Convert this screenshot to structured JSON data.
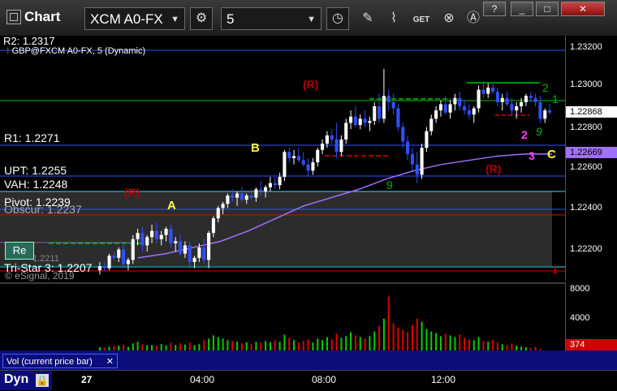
{
  "window": {
    "title": "Chart",
    "help": "?",
    "minimize": "_",
    "maximize": "□",
    "close": "✕"
  },
  "toolbar": {
    "symbol": "XCM A0-FX",
    "interval": "5"
  },
  "chart": {
    "legend": "GBP@FXCM A0-FX, 5 (Dynamic)",
    "copyright": "© eSignal, 2019",
    "r2_partial": "R2: 1.2317",
    "levels": {
      "r1": "R1: 1.2271",
      "upt": "UPT: 1.2255",
      "vah": "VAH: 1.2248",
      "pivot": "Pivot: 1.2239",
      "obscured": "Obscur: 1.2237",
      "tristar": "Tri-Star 3: 1.2207",
      "mini": "1.2211"
    },
    "axis_prices": [
      "1.23200",
      "1.23000",
      "1.22800",
      "1.22600",
      "1.22400",
      "1.22200"
    ],
    "last_price": "1.22868",
    "vwap_price": "1.22669",
    "button_label": "Re",
    "markers": {
      "a": "A",
      "b": "B",
      "c": "C",
      "r_top": "(R)",
      "r_left": "(R)",
      "r_right": "(R)",
      "n9": "9",
      "n2": "2",
      "n3": "3",
      "n1": "1",
      "n9b": "9",
      "n2b": "2",
      "n1b": "1"
    }
  },
  "volume": {
    "label": "Vol (current price bar)",
    "axis_prices": [
      "8000",
      "4000"
    ],
    "current": "374"
  },
  "timeline": {
    "label": "Dyn",
    "ticks": [
      "27",
      "04:00",
      "08:00",
      "12:00"
    ]
  },
  "colors": {
    "green": "#00d000",
    "blue": "#3050ff",
    "red": "#e00000",
    "purple": "#a070ff",
    "yellow": "#ffff40",
    "magenta": "#ff40ff",
    "darkred": "#b00000",
    "lock_orange": "#e08000"
  },
  "chart_data": {
    "type": "candlestick",
    "ohlc": [
      [
        1.2211,
        1.2215,
        1.2209,
        1.2213
      ],
      [
        1.2213,
        1.2215,
        1.2211,
        1.2212
      ],
      [
        1.2212,
        1.2219,
        1.2211,
        1.2218
      ],
      [
        1.2218,
        1.222,
        1.2216,
        1.2217
      ],
      [
        1.2217,
        1.2222,
        1.2215,
        1.2221
      ],
      [
        1.2221,
        1.2223,
        1.2212,
        1.2214
      ],
      [
        1.2214,
        1.2217,
        1.2211,
        1.2216
      ],
      [
        1.2216,
        1.2228,
        1.2214,
        1.2226
      ],
      [
        1.2226,
        1.2231,
        1.2223,
        1.2229
      ],
      [
        1.2229,
        1.2232,
        1.222,
        1.2223
      ],
      [
        1.2223,
        1.2228,
        1.222,
        1.2227
      ],
      [
        1.2227,
        1.2233,
        1.2224,
        1.223
      ],
      [
        1.223,
        1.2234,
        1.2224,
        1.2226
      ],
      [
        1.2226,
        1.223,
        1.2223,
        1.2228
      ],
      [
        1.2228,
        1.2232,
        1.2225,
        1.2231
      ],
      [
        1.2231,
        1.2233,
        1.2222,
        1.2224
      ],
      [
        1.2224,
        1.2227,
        1.222,
        1.2225
      ],
      [
        1.2225,
        1.2228,
        1.2218,
        1.2219
      ],
      [
        1.2219,
        1.2225,
        1.2217,
        1.2223
      ],
      [
        1.2223,
        1.2225,
        1.2212,
        1.2215
      ],
      [
        1.2215,
        1.2218,
        1.2212,
        1.2217
      ],
      [
        1.2217,
        1.2224,
        1.2215,
        1.2222
      ],
      [
        1.2222,
        1.2226,
        1.2214,
        1.2216
      ],
      [
        1.2216,
        1.223,
        1.2212,
        1.2229
      ],
      [
        1.2229,
        1.2237,
        1.2227,
        1.2236
      ],
      [
        1.2236,
        1.2242,
        1.2234,
        1.2241
      ],
      [
        1.2241,
        1.2244,
        1.2238,
        1.2243
      ],
      [
        1.2243,
        1.2248,
        1.2241,
        1.2247
      ],
      [
        1.2247,
        1.225,
        1.2244,
        1.2246
      ],
      [
        1.2246,
        1.2249,
        1.2242,
        1.2248
      ],
      [
        1.2248,
        1.2251,
        1.2244,
        1.2245
      ],
      [
        1.2245,
        1.2248,
        1.2243,
        1.2247
      ],
      [
        1.2247,
        1.225,
        1.2245,
        1.2246
      ],
      [
        1.2246,
        1.2251,
        1.2244,
        1.225
      ],
      [
        1.225,
        1.2254,
        1.2247,
        1.2249
      ],
      [
        1.2249,
        1.2252,
        1.2246,
        1.2251
      ],
      [
        1.2251,
        1.2256,
        1.2249,
        1.2253
      ],
      [
        1.2253,
        1.2256,
        1.225,
        1.2252
      ],
      [
        1.2252,
        1.2258,
        1.225,
        1.2256
      ],
      [
        1.2256,
        1.2269,
        1.2254,
        1.2268
      ],
      [
        1.2268,
        1.227,
        1.2263,
        1.2265
      ],
      [
        1.2265,
        1.2269,
        1.2262,
        1.2266
      ],
      [
        1.2266,
        1.227,
        1.2263,
        1.2264
      ],
      [
        1.2264,
        1.2268,
        1.2261,
        1.2262
      ],
      [
        1.2262,
        1.2265,
        1.2256,
        1.2259
      ],
      [
        1.2259,
        1.2265,
        1.2257,
        1.2263
      ],
      [
        1.2263,
        1.227,
        1.2261,
        1.2269
      ],
      [
        1.2269,
        1.2274,
        1.2267,
        1.2272
      ],
      [
        1.2272,
        1.2278,
        1.227,
        1.2276
      ],
      [
        1.2276,
        1.2279,
        1.2272,
        1.2274
      ],
      [
        1.2274,
        1.2282,
        1.2265,
        1.2268
      ],
      [
        1.2268,
        1.2276,
        1.2266,
        1.2274
      ],
      [
        1.2274,
        1.2284,
        1.2272,
        1.2282
      ],
      [
        1.2282,
        1.2288,
        1.2279,
        1.2285
      ],
      [
        1.2285,
        1.229,
        1.228,
        1.2281
      ],
      [
        1.2281,
        1.2286,
        1.2279,
        1.2284
      ],
      [
        1.2284,
        1.2288,
        1.228,
        1.2282
      ],
      [
        1.2282,
        1.2285,
        1.2278,
        1.2283
      ],
      [
        1.2283,
        1.2292,
        1.2281,
        1.229
      ],
      [
        1.229,
        1.2296,
        1.2282,
        1.2284
      ],
      [
        1.2284,
        1.2308,
        1.2282,
        1.2295
      ],
      [
        1.2295,
        1.2298,
        1.2288,
        1.2292
      ],
      [
        1.2292,
        1.2296,
        1.2286,
        1.2289
      ],
      [
        1.2289,
        1.2291,
        1.2278,
        1.228
      ],
      [
        1.228,
        1.2282,
        1.227,
        1.2273
      ],
      [
        1.2273,
        1.2276,
        1.2264,
        1.2267
      ],
      [
        1.2267,
        1.227,
        1.2259,
        1.2262
      ],
      [
        1.2262,
        1.2268,
        1.2253,
        1.2257
      ],
      [
        1.2257,
        1.2272,
        1.2255,
        1.227
      ],
      [
        1.227,
        1.228,
        1.2268,
        1.2278
      ],
      [
        1.2278,
        1.2286,
        1.2276,
        1.2284
      ],
      [
        1.2284,
        1.229,
        1.2282,
        1.2288
      ],
      [
        1.2288,
        1.2293,
        1.2285,
        1.2291
      ],
      [
        1.2291,
        1.2295,
        1.2286,
        1.2287
      ],
      [
        1.2287,
        1.2293,
        1.2284,
        1.2291
      ],
      [
        1.2291,
        1.2296,
        1.2288,
        1.2294
      ],
      [
        1.2294,
        1.2297,
        1.2288,
        1.229
      ],
      [
        1.229,
        1.2293,
        1.2286,
        1.2288
      ],
      [
        1.2288,
        1.2291,
        1.2284,
        1.2286
      ],
      [
        1.2286,
        1.229,
        1.2282,
        1.2289
      ],
      [
        1.2289,
        1.23,
        1.2287,
        1.2298
      ],
      [
        1.2298,
        1.2302,
        1.2294,
        1.2296
      ],
      [
        1.2296,
        1.2301,
        1.2294,
        1.2299
      ],
      [
        1.2299,
        1.2301,
        1.2296,
        1.2297
      ],
      [
        1.2297,
        1.2299,
        1.229,
        1.2292
      ],
      [
        1.2292,
        1.2296,
        1.2288,
        1.2294
      ],
      [
        1.2294,
        1.2297,
        1.229,
        1.2291
      ],
      [
        1.2291,
        1.2294,
        1.2286,
        1.2288
      ],
      [
        1.2288,
        1.2292,
        1.2284,
        1.229
      ],
      [
        1.229,
        1.2294,
        1.2287,
        1.2292
      ],
      [
        1.2292,
        1.2296,
        1.229,
        1.2295
      ],
      [
        1.2295,
        1.2297,
        1.2292,
        1.2294
      ],
      [
        1.2294,
        1.2296,
        1.229,
        1.2292
      ],
      [
        1.2292,
        1.2295,
        1.2282,
        1.2284
      ],
      [
        1.2284,
        1.2289,
        1.2282,
        1.2288
      ],
      [
        1.2288,
        1.2291,
        1.2286,
        1.2287
      ]
    ],
    "volume": [
      620,
      540,
      700,
      760,
      820,
      900,
      650,
      1100,
      1300,
      980,
      870,
      900,
      800,
      1000,
      850,
      1200,
      900,
      1100,
      950,
      1200,
      880,
      1000,
      1500,
      1700,
      2100,
      1900,
      1700,
      1500,
      1400,
      1300,
      1100,
      1250,
      1000,
      1300,
      1200,
      1400,
      1250,
      1500,
      1300,
      2200,
      1800,
      1500,
      1200,
      1400,
      1600,
      1200,
      1700,
      1500,
      1900,
      1600,
      2300,
      1800,
      2000,
      2500,
      2100,
      1900,
      1700,
      2000,
      2600,
      3300,
      4200,
      7000,
      3600,
      3100,
      2800,
      2500,
      3400,
      4200,
      3800,
      2900,
      2600,
      2400,
      2000,
      2300,
      2100,
      1900,
      2200,
      1800,
      1600,
      1500,
      1900,
      1400,
      1300,
      1500,
      1200,
      1000,
      900,
      1100,
      800,
      700,
      600,
      500,
      650,
      374
    ],
    "ylim": [
      1.2206,
      1.2324
    ],
    "vol_ylim": [
      0,
      8600
    ],
    "vwap": [
      1.2217,
      1.2219,
      1.2222,
      1.2225,
      1.223,
      1.2236,
      1.2242,
      1.2246,
      1.225,
      1.2255,
      1.2259,
      1.2262,
      1.2264,
      1.2266,
      1.2267,
      1.2267
    ]
  }
}
